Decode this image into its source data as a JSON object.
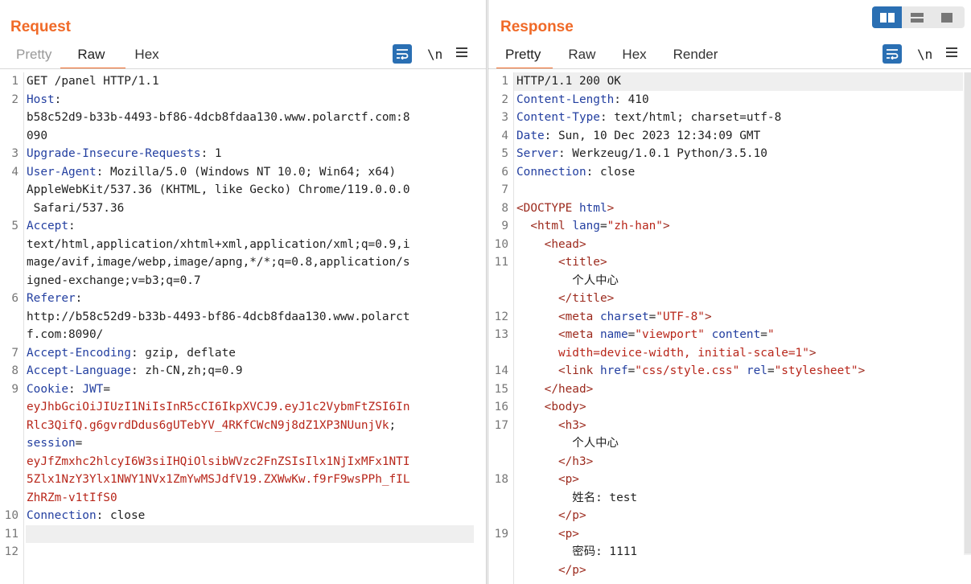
{
  "request": {
    "title": "Request",
    "tabs": [
      "Pretty",
      "Raw",
      "Hex"
    ],
    "active_tab": "Raw",
    "newline_label": "\\n",
    "lines": [
      {
        "n": "1",
        "segs": [
          [
            "txt",
            "GET /panel HTTP/1.1"
          ]
        ]
      },
      {
        "n": "2",
        "segs": [
          [
            "k",
            "Host"
          ],
          [
            "txt",
            ":"
          ]
        ]
      },
      {
        "n": "",
        "segs": [
          [
            "txt",
            "b58c52d9-b33b-4493-bf86-4dcb8fdaa130.www.polarctf.com:8"
          ]
        ]
      },
      {
        "n": "",
        "segs": [
          [
            "txt",
            "090"
          ]
        ]
      },
      {
        "n": "3",
        "segs": [
          [
            "k",
            "Upgrade-Insecure-Requests"
          ],
          [
            "txt",
            ": 1"
          ]
        ]
      },
      {
        "n": "4",
        "segs": [
          [
            "k",
            "User-Agent"
          ],
          [
            "txt",
            ": Mozilla/5.0 (Windows NT 10.0; Win64; x64)"
          ]
        ]
      },
      {
        "n": "",
        "segs": [
          [
            "txt",
            "AppleWebKit/537.36 (KHTML, like Gecko) Chrome/119.0.0.0"
          ]
        ]
      },
      {
        "n": "",
        "segs": [
          [
            "txt",
            " Safari/537.36"
          ]
        ]
      },
      {
        "n": "5",
        "segs": [
          [
            "k",
            "Accept"
          ],
          [
            "txt",
            ":"
          ]
        ]
      },
      {
        "n": "",
        "segs": [
          [
            "txt",
            "text/html,application/xhtml+xml,application/xml;q=0.9,i"
          ]
        ]
      },
      {
        "n": "",
        "segs": [
          [
            "txt",
            "mage/avif,image/webp,image/apng,*/*;q=0.8,application/s"
          ]
        ]
      },
      {
        "n": "",
        "segs": [
          [
            "txt",
            "igned-exchange;v=b3;q=0.7"
          ]
        ]
      },
      {
        "n": "6",
        "segs": [
          [
            "k",
            "Referer"
          ],
          [
            "txt",
            ":"
          ]
        ]
      },
      {
        "n": "",
        "segs": [
          [
            "txt",
            "http://b58c52d9-b33b-4493-bf86-4dcb8fdaa130.www.polarct"
          ]
        ]
      },
      {
        "n": "",
        "segs": [
          [
            "txt",
            "f.com:8090/"
          ]
        ]
      },
      {
        "n": "7",
        "segs": [
          [
            "k",
            "Accept-Encoding"
          ],
          [
            "txt",
            ": gzip, deflate"
          ]
        ]
      },
      {
        "n": "8",
        "segs": [
          [
            "k",
            "Accept-Language"
          ],
          [
            "txt",
            ": zh-CN,zh;q=0.9"
          ]
        ]
      },
      {
        "n": "9",
        "segs": [
          [
            "k",
            "Cookie"
          ],
          [
            "txt",
            ": "
          ],
          [
            "k",
            "JWT"
          ],
          [
            "txt",
            "="
          ]
        ]
      },
      {
        "n": "",
        "segs": [
          [
            "r",
            "eyJhbGciOiJIUzI1NiIsInR5cCI6IkpXVCJ9.eyJ1c2VybmFtZSI6In"
          ]
        ]
      },
      {
        "n": "",
        "segs": [
          [
            "r",
            "Rlc3QifQ.g6gvrdDdus6gUTebYV_4RKfCWcN9j8dZ1XP3NUunjVk"
          ],
          [
            "txt",
            ";"
          ]
        ]
      },
      {
        "n": "",
        "segs": [
          [
            "k",
            "session"
          ],
          [
            "txt",
            "="
          ]
        ]
      },
      {
        "n": "",
        "segs": [
          [
            "r",
            "eyJfZmxhc2hlcyI6W3siIHQiOlsibWVzc2FnZSIsIlx1NjIxMFx1NTI"
          ]
        ]
      },
      {
        "n": "",
        "segs": [
          [
            "r",
            "5Zlx1NzY3Ylx1NWY1NVx1ZmYwMSJdfV19.ZXWwKw.f9rF9wsPPh_fIL"
          ]
        ]
      },
      {
        "n": "",
        "segs": [
          [
            "r",
            "ZhRZm-v1tIfS0"
          ]
        ]
      },
      {
        "n": "10",
        "segs": [
          [
            "k",
            "Connection"
          ],
          [
            "txt",
            ": close"
          ]
        ]
      },
      {
        "n": "11",
        "segs": [
          [
            "txt",
            ""
          ]
        ],
        "highlight": true
      },
      {
        "n": "12",
        "segs": [
          [
            "txt",
            ""
          ]
        ]
      }
    ]
  },
  "response": {
    "title": "Response",
    "tabs": [
      "Pretty",
      "Raw",
      "Hex",
      "Render"
    ],
    "active_tab": "Pretty",
    "newline_label": "\\n",
    "lines": [
      {
        "n": "1",
        "segs": [
          [
            "txt",
            "HTTP/1.1 200 OK"
          ]
        ],
        "highlight": true
      },
      {
        "n": "2",
        "segs": [
          [
            "k",
            "Content-Length"
          ],
          [
            "txt",
            ": 410"
          ]
        ]
      },
      {
        "n": "3",
        "segs": [
          [
            "k",
            "Content-Type"
          ],
          [
            "txt",
            ": text/html; charset=utf-8"
          ]
        ]
      },
      {
        "n": "4",
        "segs": [
          [
            "k",
            "Date"
          ],
          [
            "txt",
            ": Sun, 10 Dec 2023 12:34:09 GMT"
          ]
        ]
      },
      {
        "n": "5",
        "segs": [
          [
            "k",
            "Server"
          ],
          [
            "txt",
            ": Werkzeug/1.0.1 Python/3.5.10"
          ]
        ]
      },
      {
        "n": "6",
        "segs": [
          [
            "k",
            "Connection"
          ],
          [
            "txt",
            ": close"
          ]
        ]
      },
      {
        "n": "7",
        "segs": [
          [
            "txt",
            ""
          ]
        ]
      },
      {
        "n": "8",
        "segs": [
          [
            "tag",
            "<DOCTYPE "
          ],
          [
            "attr",
            "html"
          ],
          [
            "tag",
            ">"
          ]
        ]
      },
      {
        "n": "9",
        "segs": [
          [
            "txt",
            "  "
          ],
          [
            "tag",
            "<html "
          ],
          [
            "attr",
            "lang"
          ],
          [
            "txt",
            "="
          ],
          [
            "val",
            "\"zh-han\""
          ],
          [
            "tag",
            ">"
          ]
        ]
      },
      {
        "n": "10",
        "segs": [
          [
            "txt",
            "    "
          ],
          [
            "tag",
            "<head>"
          ]
        ]
      },
      {
        "n": "11",
        "segs": [
          [
            "txt",
            "      "
          ],
          [
            "tag",
            "<title>"
          ]
        ]
      },
      {
        "n": "",
        "segs": [
          [
            "txt",
            "        个人中心"
          ]
        ]
      },
      {
        "n": "",
        "segs": [
          [
            "txt",
            "      "
          ],
          [
            "tag",
            "</title>"
          ]
        ]
      },
      {
        "n": "12",
        "segs": [
          [
            "txt",
            "      "
          ],
          [
            "tag",
            "<meta "
          ],
          [
            "attr",
            "charset"
          ],
          [
            "txt",
            "="
          ],
          [
            "val",
            "\"UTF-8\""
          ],
          [
            "tag",
            ">"
          ]
        ]
      },
      {
        "n": "13",
        "segs": [
          [
            "txt",
            "      "
          ],
          [
            "tag",
            "<meta "
          ],
          [
            "attr",
            "name"
          ],
          [
            "txt",
            "="
          ],
          [
            "val",
            "\"viewport\""
          ],
          [
            "txt",
            " "
          ],
          [
            "attr",
            "content"
          ],
          [
            "txt",
            "="
          ],
          [
            "val",
            "\""
          ]
        ]
      },
      {
        "n": "",
        "segs": [
          [
            "txt",
            "      "
          ],
          [
            "val",
            "width=device-width, initial-scale=1\""
          ],
          [
            "tag",
            ">"
          ]
        ]
      },
      {
        "n": "14",
        "segs": [
          [
            "txt",
            "      "
          ],
          [
            "tag",
            "<link "
          ],
          [
            "attr",
            "href"
          ],
          [
            "txt",
            "="
          ],
          [
            "val",
            "\"css/style.css\""
          ],
          [
            "txt",
            " "
          ],
          [
            "attr",
            "rel"
          ],
          [
            "txt",
            "="
          ],
          [
            "val",
            "\"stylesheet\""
          ],
          [
            "tag",
            ">"
          ]
        ]
      },
      {
        "n": "15",
        "segs": [
          [
            "txt",
            "    "
          ],
          [
            "tag",
            "</head>"
          ]
        ]
      },
      {
        "n": "16",
        "segs": [
          [
            "txt",
            "    "
          ],
          [
            "tag",
            "<body>"
          ]
        ]
      },
      {
        "n": "17",
        "segs": [
          [
            "txt",
            "      "
          ],
          [
            "tag",
            "<h3>"
          ]
        ]
      },
      {
        "n": "",
        "segs": [
          [
            "txt",
            "        个人中心"
          ]
        ]
      },
      {
        "n": "",
        "segs": [
          [
            "txt",
            "      "
          ],
          [
            "tag",
            "</h3>"
          ]
        ]
      },
      {
        "n": "18",
        "segs": [
          [
            "txt",
            "      "
          ],
          [
            "tag",
            "<p>"
          ]
        ]
      },
      {
        "n": "",
        "segs": [
          [
            "txt",
            "        姓名: test"
          ]
        ]
      },
      {
        "n": "",
        "segs": [
          [
            "txt",
            "      "
          ],
          [
            "tag",
            "</p>"
          ]
        ]
      },
      {
        "n": "19",
        "segs": [
          [
            "txt",
            "      "
          ],
          [
            "tag",
            "<p>"
          ]
        ]
      },
      {
        "n": "",
        "segs": [
          [
            "txt",
            "        密码: 1111"
          ]
        ]
      },
      {
        "n": "",
        "segs": [
          [
            "txt",
            "      "
          ],
          [
            "tag",
            "</p>"
          ]
        ]
      }
    ]
  },
  "layout_buttons": [
    "side-by-side-icon",
    "stacked-icon",
    "single-icon"
  ],
  "colors": {
    "accent": "#f06a28",
    "blue": "#2a6fb3",
    "key": "#233fa0",
    "value": "#b8261a"
  }
}
